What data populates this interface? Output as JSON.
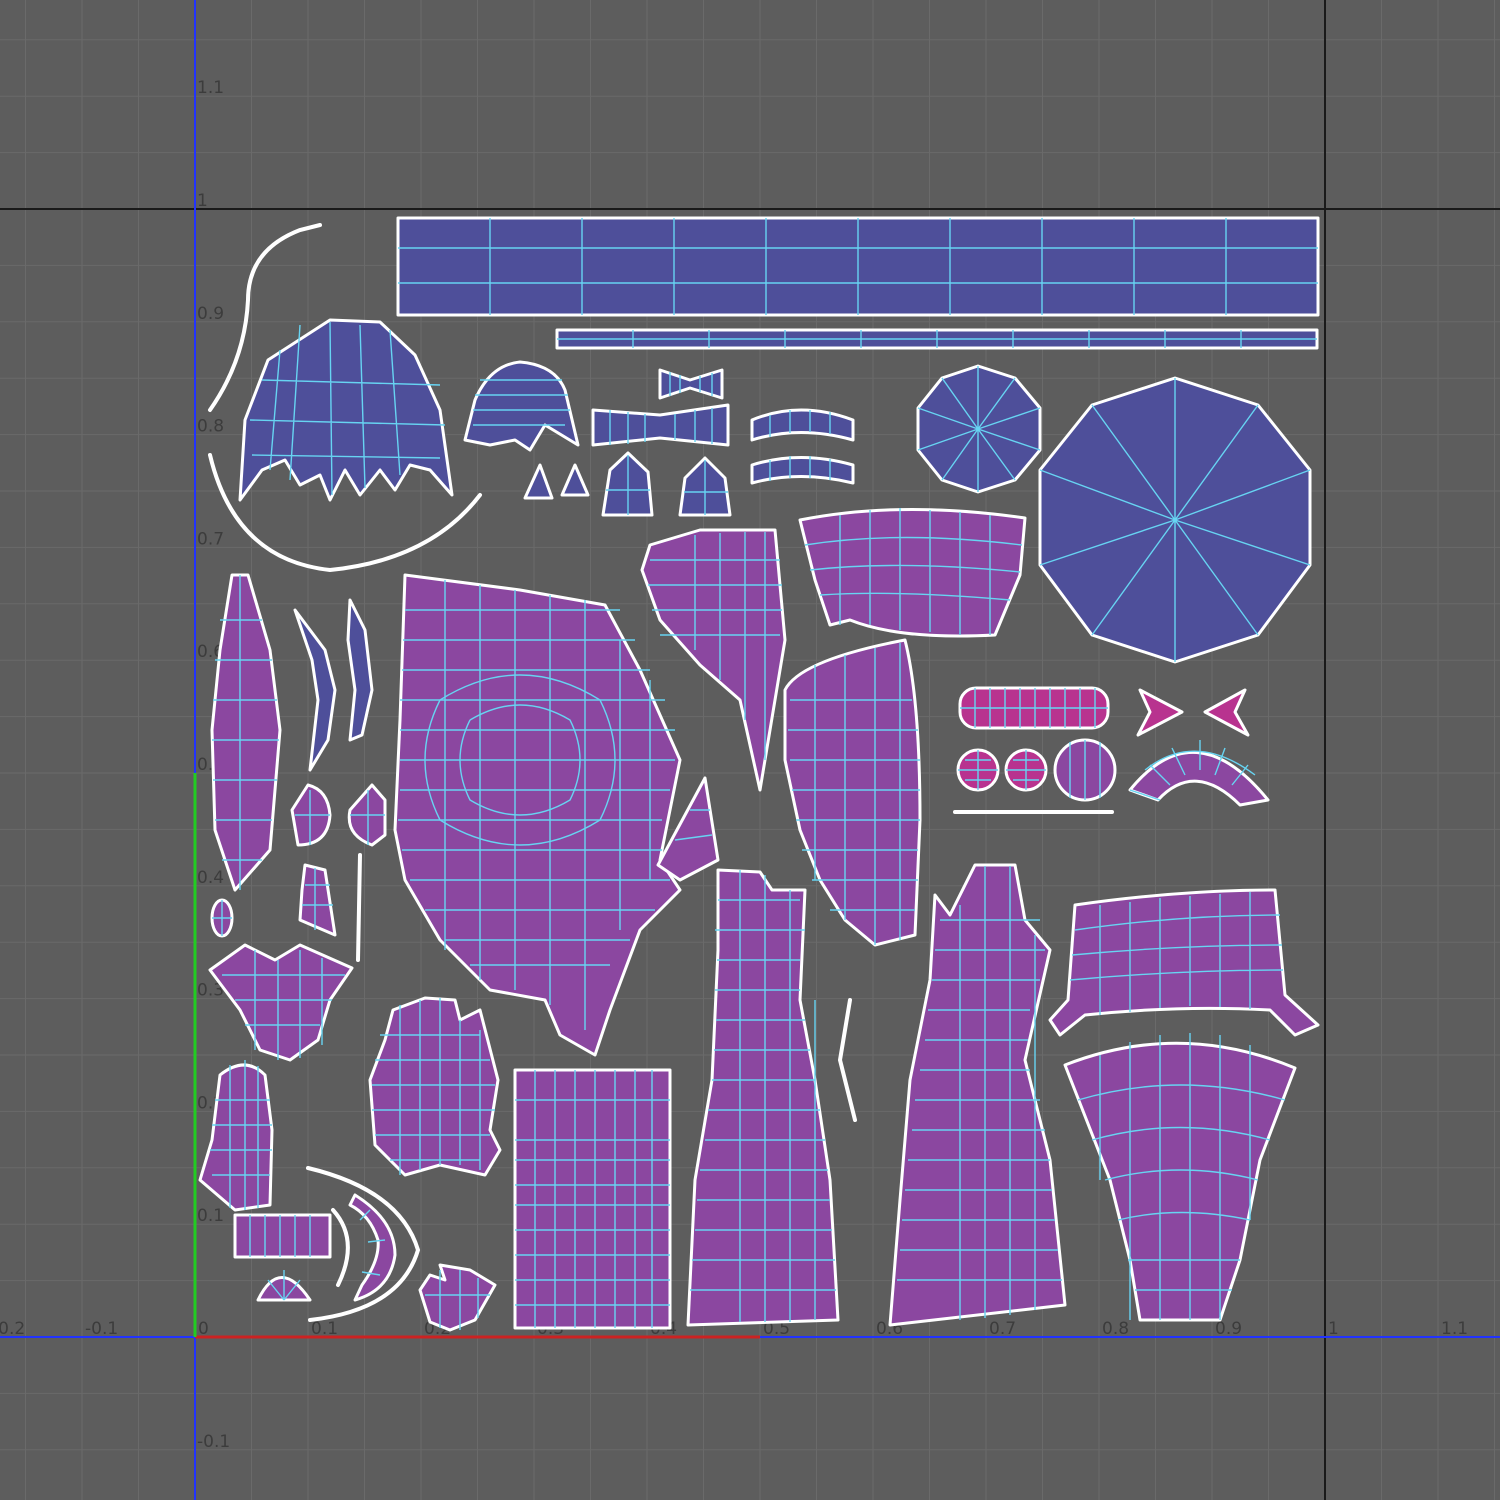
{
  "editor": {
    "panel": "UV Texture Editor",
    "tick_labels_u": [
      "-0.2",
      "-0.1",
      "0",
      "0.1",
      "0.2",
      "0.3",
      "0.4",
      "0.5",
      "0.6",
      "0.7",
      "0.8",
      "0.9",
      "1",
      "1.1"
    ],
    "tick_labels_v": [
      "-0.1",
      "0.1",
      "0.2",
      "0.3",
      "0.4",
      "0.5",
      "0.6",
      "0.7",
      "0.8",
      "0.9",
      "1",
      "1.1"
    ],
    "colors": {
      "background": "#5d5d5d",
      "grid_minor": "#6a6a6a",
      "grid_major": "#1a1a1a",
      "axis": "#2233ff",
      "u_axis_highlight": "#cc2222",
      "v_axis_highlight": "#22cc22",
      "shell_front": "#8b47a0",
      "shell_back": "#4e4f9a",
      "shell_pink": "#b8338f",
      "wireframe": "#67d4f2",
      "border": "#ffffff"
    },
    "uv_range": {
      "u": [
        -0.2,
        1.15
      ],
      "v": [
        -0.15,
        1.2
      ]
    }
  }
}
